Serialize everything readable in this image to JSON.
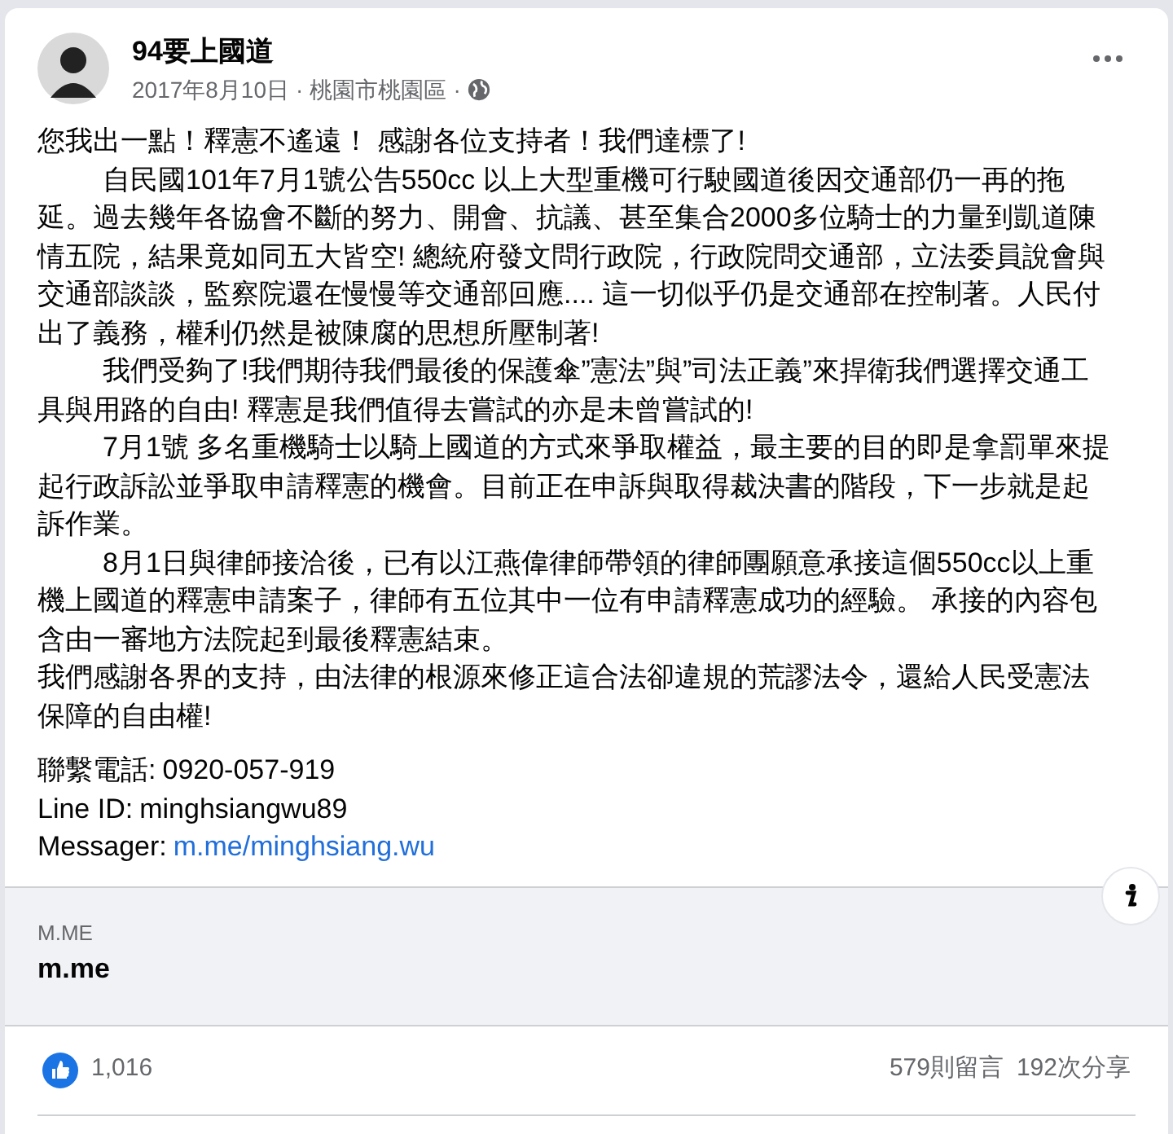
{
  "post": {
    "author": "94要上國道",
    "date": "2017年8月10日",
    "separator_1": "·",
    "location": "桃園市桃園區",
    "separator_2": "·",
    "paragraphs": [
      {
        "text": "您我出一點！釋憲不遙遠！ 感謝各位支持者！我們達標了!",
        "indent": false
      },
      {
        "text": "自民國101年7月1號公告550cc 以上大型重機可行駛國道後因交通部仍一再的拖延。過去幾年各協會不斷的努力、開會、抗議、甚至集合2000多位騎士的力量到凱道陳情五院，結果竟如同五大皆空! 總統府發文問行政院，行政院問交通部，立法委員說會與交通部談談，監察院還在慢慢等交通部回應.... 這一切似乎仍是交通部在控制著。人民付出了義務，權利仍然是被陳腐的思想所壓制著!",
        "indent": true
      },
      {
        "text": "我們受夠了!我們期待我們最後的保護傘”憲法”與”司法正義”來捍衛我們選擇交通工具與用路的自由! 釋憲是我們值得去嘗試的亦是未曾嘗試的!",
        "indent": true
      },
      {
        "text": "7月1號 多名重機騎士以騎上國道的方式來爭取權益，最主要的目的即是拿罰單來提起行政訴訟並爭取申請釋憲的機會。目前正在申訴與取得裁決書的階段，下一步就是起訴作業。",
        "indent": true
      },
      {
        "text": "8月1日與律師接洽後，已有以江燕偉律師帶領的律師團願意承接這個550cc以上重機上國道的釋憲申請案子，律師有五位其中一位有申請釋憲成功的經驗。 承接的內容包含由一審地方法院起到最後釋憲結束。",
        "indent": true
      },
      {
        "text": "我們感謝各界的支持，由法律的根源來修正這合法卻違規的荒謬法令，還給人民受憲法保障的自由權!",
        "indent": false
      }
    ],
    "contacts": [
      {
        "label": "聯繫電話: ",
        "value": "0920-057-919",
        "kind": "text"
      },
      {
        "label": "Line ID: ",
        "value": "minghsiangwu89",
        "kind": "text"
      },
      {
        "label": "Messager: ",
        "value": "m.me/minghsiang.wu",
        "kind": "link"
      }
    ]
  },
  "link_preview": {
    "domain": "M.ME",
    "title": "m.me"
  },
  "footer": {
    "reactions": "1,016",
    "comments": "579則留言",
    "shares": "192次分享"
  }
}
